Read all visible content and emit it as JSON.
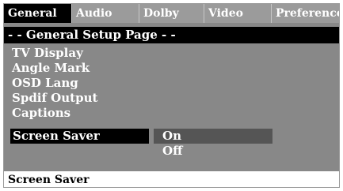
{
  "tabs": [
    {
      "label": "General",
      "active": true
    },
    {
      "label": "Audio",
      "active": false
    },
    {
      "label": "Dolby",
      "active": false
    },
    {
      "label": "Video",
      "active": false
    },
    {
      "label": "Preference",
      "active": false
    }
  ],
  "page_header": "- - General Setup Page - -",
  "menu": {
    "items": [
      {
        "label": "TV Display"
      },
      {
        "label": "Angle Mark"
      },
      {
        "label": "OSD Lang"
      },
      {
        "label": "Spdif Output"
      },
      {
        "label": "Captions"
      },
      {
        "label": "Screen Saver",
        "selected": true
      }
    ]
  },
  "options": [
    {
      "label": "On",
      "highlighted": true
    },
    {
      "label": "Off",
      "highlighted": false
    }
  ],
  "status_text": "Screen Saver",
  "colors": {
    "panel_background": "#888888",
    "tab_bar_background": "#9b9b9b",
    "active_tab_background": "#000000",
    "header_background": "#000000",
    "selected_item_background": "#000000",
    "highlighted_option_background": "#555555",
    "text": "#ffffff",
    "status_background": "#ffffff",
    "status_text": "#000000"
  }
}
